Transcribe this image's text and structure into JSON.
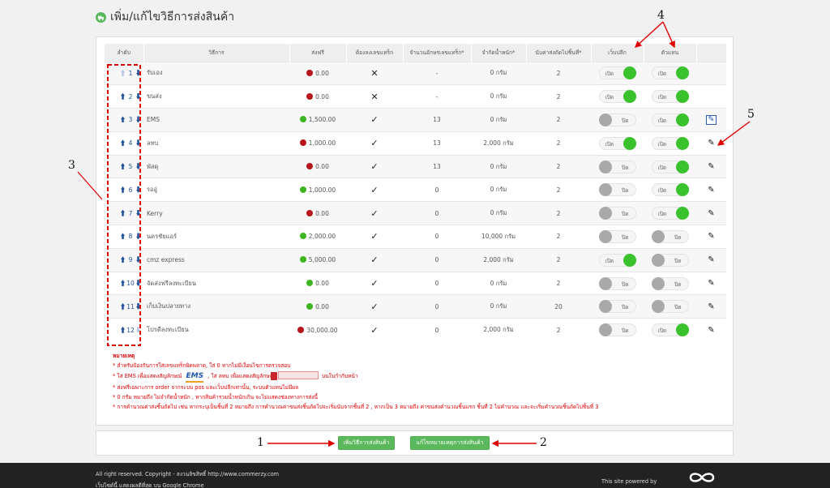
{
  "page": {
    "title": "เพิ่ม/แก้ไขวิธีการส่งสินค้า"
  },
  "table": {
    "headers": {
      "order": "ลำดับ",
      "method": "วิธีการ",
      "free": "ส่งฟรี",
      "tracking": "ต้องลงเลขแทร็ก",
      "track_len": "จำนวนอักษรเลขแทร็ก*",
      "weight": "จำกัดน้ำหนัก*",
      "count": "นับค่าส่งถัดไปชิ้นที่*",
      "web": "เว็บปลีก",
      "agent": "ตัวแทน"
    },
    "rows": [
      {
        "order": "1",
        "name": "รับเอง",
        "free": "0.00",
        "free_color": "red",
        "tracking": "✕",
        "len": "-",
        "weight": "0 กรัม",
        "count": "2",
        "web_label": "เปิด",
        "web_on": true,
        "agent_label": "เปิด",
        "agent_on": true,
        "edit": false,
        "edit_boxed": false,
        "up_enabled": false,
        "down_enabled": true
      },
      {
        "order": "2",
        "name": "ขนส่ง",
        "free": "0.00",
        "free_color": "red",
        "tracking": "✕",
        "len": "-",
        "weight": "0 กรัม",
        "count": "2",
        "web_label": "เปิด",
        "web_on": true,
        "agent_label": "เปิด",
        "agent_on": true,
        "edit": false,
        "edit_boxed": false,
        "up_enabled": true,
        "down_enabled": true
      },
      {
        "order": "3",
        "name": "EMS",
        "free": "1,500.00",
        "free_color": "green",
        "tracking": "✓",
        "len": "13",
        "weight": "0 กรัม",
        "count": "2",
        "web_label": "ปิด",
        "web_on": false,
        "agent_label": "เปิด",
        "agent_on": true,
        "edit": true,
        "edit_boxed": true,
        "up_enabled": true,
        "down_enabled": true
      },
      {
        "order": "4",
        "name": "ลทบ",
        "free": "1,000.00",
        "free_color": "red",
        "tracking": "✓",
        "len": "13",
        "weight": "2,000 กรัม",
        "count": "2",
        "web_label": "เปิด",
        "web_on": true,
        "agent_label": "เปิด",
        "agent_on": true,
        "edit": true,
        "edit_boxed": false,
        "up_enabled": true,
        "down_enabled": true
      },
      {
        "order": "5",
        "name": "พัสดุ",
        "free": "0.00",
        "free_color": "red",
        "tracking": "✓",
        "len": "13",
        "weight": "0 กรัม",
        "count": "2",
        "web_label": "ปิด",
        "web_on": false,
        "agent_label": "เปิด",
        "agent_on": true,
        "edit": true,
        "edit_boxed": false,
        "up_enabled": true,
        "down_enabled": true
      },
      {
        "order": "6",
        "name": "รออู่",
        "free": "1,000.00",
        "free_color": "green",
        "tracking": "✓",
        "len": "0",
        "weight": "0 กรัม",
        "count": "2",
        "web_label": "ปิด",
        "web_on": false,
        "agent_label": "เปิด",
        "agent_on": true,
        "edit": true,
        "edit_boxed": false,
        "up_enabled": true,
        "down_enabled": true
      },
      {
        "order": "7",
        "name": "Kerry",
        "free": "0.00",
        "free_color": "red",
        "tracking": "✓",
        "len": "0",
        "weight": "0 กรัม",
        "count": "2",
        "web_label": "ปิด",
        "web_on": false,
        "agent_label": "เปิด",
        "agent_on": true,
        "edit": true,
        "edit_boxed": false,
        "up_enabled": true,
        "down_enabled": true
      },
      {
        "order": "8",
        "name": "นครชัยแอร์",
        "free": "2,000.00",
        "free_color": "green",
        "tracking": "✓",
        "len": "0",
        "weight": "10,000 กรัม",
        "count": "2",
        "web_label": "ปิด",
        "web_on": false,
        "agent_label": "ปิด",
        "agent_on": false,
        "edit": true,
        "edit_boxed": false,
        "up_enabled": true,
        "down_enabled": true
      },
      {
        "order": "9",
        "name": "cmz express",
        "free": "5,000.00",
        "free_color": "green",
        "tracking": "✓",
        "len": "0",
        "weight": "2,000 กรัม",
        "count": "2",
        "web_label": "เปิด",
        "web_on": true,
        "agent_label": "ปิด",
        "agent_on": false,
        "edit": true,
        "edit_boxed": false,
        "up_enabled": true,
        "down_enabled": true
      },
      {
        "order": "10",
        "name": "จัดส่งฟรีลงทะเบียน",
        "free": "0.00",
        "free_color": "green",
        "tracking": "✓",
        "len": "0",
        "weight": "0 กรัม",
        "count": "2",
        "web_label": "ปิด",
        "web_on": false,
        "agent_label": "ปิด",
        "agent_on": false,
        "edit": true,
        "edit_boxed": false,
        "up_enabled": true,
        "down_enabled": true
      },
      {
        "order": "11",
        "name": "เก็บเงินปลายทาง",
        "free": "0.00",
        "free_color": "green",
        "tracking": "✓",
        "len": "0",
        "weight": "0 กรัม",
        "count": "20",
        "web_label": "ปิด",
        "web_on": false,
        "agent_label": "ปิด",
        "agent_on": false,
        "edit": true,
        "edit_boxed": false,
        "up_enabled": true,
        "down_enabled": true
      },
      {
        "order": "12",
        "name": "โปรดีลงทะเบียน",
        "free": "30,000.00",
        "free_color": "red",
        "tracking": "✓",
        "len": "0",
        "weight": "2,000 กรัม",
        "count": "2",
        "web_label": "ปิด",
        "web_on": false,
        "agent_label": "เปิด",
        "agent_on": true,
        "edit": true,
        "edit_boxed": false,
        "up_enabled": true,
        "down_enabled": false
      }
    ]
  },
  "notes": {
    "title": "หมายเหตุ",
    "n1": "* สำหรับป้องกันการใส่เลขแทร็กผิดพลาด, ใส่ 0 หากไม่มีเงื่อนไขการตรวจสอบ",
    "n2a": "* ใส่ EMS เพื่อแสดงสัญลักษณ์",
    "ems_logo": "EMS",
    "n2b": ", ใส่ ลทบ เพื่อแสดงสัญลักษณ์",
    "n2c": "บนใบกำกับหน้า",
    "n3": "* ส่งฟรีเฉพาะการ order จากระบบ pos และเว็บปลีกเท่านั้น, ระบบตัวแทนไม่มีผล",
    "n4": "* 0 กรัม หมายถึง ไม่จำกัดน้ำหนัก , หากสินค้ารวมน้ำหนักเกิน จะไม่แสดงช่องทางการส่งนี้",
    "n5": "* การคำนวณค่าส่งชิ้นถัดไป เช่น หากระบุเป็นชิ้นที่ 2 หมายถึง การคำนวณค่าขนส่งชิ้นถัดไปจะเริ่มนับจากชิ้นที่ 2 , หากเป็น 3 หมายถึง ค่าขนส่งคำนวณชิ้นแรก ชิ้นที่ 2 ไม่คำนวณ และจะเริ่มคำนวณชิ้นถัดไปชิ้นที่ 3"
  },
  "buttons": {
    "add": "เพิ่มวิธีการส่งสินค้า",
    "edit_notes": "แก้ไขหมายเหตุการส่งสินค้า"
  },
  "footer": {
    "line1": "All right reserved. Copyright - สงวนลิขสิทธิ์ http://www.commerzy.com",
    "line2": "เว็บไซต์นี้ แสดงผลดีที่สุด บน Google Chrome",
    "powered": "This site powered by"
  },
  "annotations": {
    "a1": "1",
    "a2": "2",
    "a3": "3",
    "a4": "4",
    "a5": "5"
  },
  "colors": {
    "green": "#5cb85c",
    "toggle_on": "#39c22c",
    "red_dot": "#b8141c",
    "annotation_red": "#e00000"
  },
  "icons": {
    "title": "truck-icon",
    "edit": "pencil-icon",
    "up": "arrow-up-icon",
    "down": "arrow-down-icon",
    "logo": "infinity-icon"
  }
}
